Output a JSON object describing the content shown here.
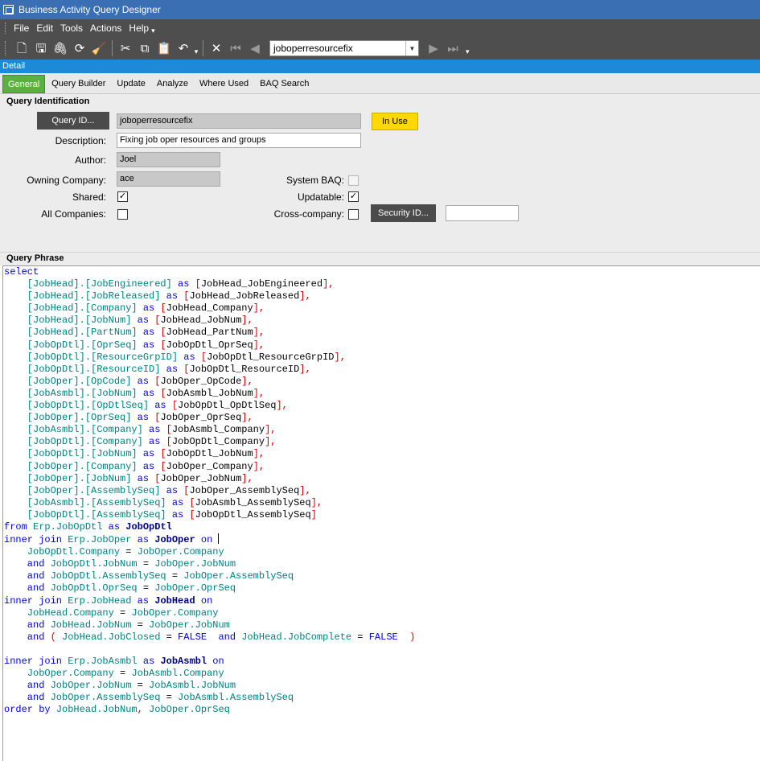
{
  "window": {
    "title": "Business Activity Query Designer"
  },
  "menu": [
    "File",
    "Edit",
    "Tools",
    "Actions",
    "Help"
  ],
  "toolbar": {
    "icons": [
      "new-icon",
      "save-icon",
      "attach-icon",
      "refresh-icon",
      "clear-icon",
      "cut-icon",
      "copy-icon",
      "paste-icon",
      "undo-icon",
      "delete-icon",
      "first-record-icon",
      "previous-record-icon",
      "next-record-icon",
      "last-record-icon"
    ],
    "record_combo_value": "joboperresourcefix"
  },
  "detail_bar": "Detail",
  "tabs": [
    "General",
    "Query Builder",
    "Update",
    "Analyze",
    "Where Used",
    "BAQ Search"
  ],
  "query_identification": {
    "section_title": "Query Identification",
    "query_id_button": "Query ID...",
    "query_id_value": "joboperresourcefix",
    "in_use_label": "In Use",
    "description_label": "Description:",
    "description_value": "Fixing job oper resources and groups",
    "author_label": "Author:",
    "author_value": "Joel",
    "owning_company_label": "Owning Company:",
    "owning_company_value": "ace",
    "system_baq_label": "System BAQ:",
    "system_baq_checked": false,
    "shared_label": "Shared:",
    "shared_checked": true,
    "updatable_label": "Updatable:",
    "updatable_checked": true,
    "all_companies_label": "All Companies:",
    "all_companies_checked": false,
    "cross_company_label": "Cross-company:",
    "cross_company_checked": false,
    "security_id_button": "Security ID...",
    "security_id_value": ""
  },
  "query_phrase": {
    "section_title": "Query Phrase",
    "lines": [
      [
        [
          "kw",
          "select"
        ]
      ],
      [
        [
          "id",
          "    [JobHead].[JobEngineered]"
        ],
        [
          "kw",
          " as "
        ],
        [
          "sym",
          "["
        ],
        [
          "alias",
          "JobHead_JobEngineered"
        ],
        [
          "sym",
          "],"
        ]
      ],
      [
        [
          "id",
          "    [JobHead].[JobReleased]"
        ],
        [
          "kw",
          " as "
        ],
        [
          "sym",
          "["
        ],
        [
          "alias",
          "JobHead_JobReleased"
        ],
        [
          "sym",
          "],"
        ]
      ],
      [
        [
          "id",
          "    [JobHead].[Company]"
        ],
        [
          "kw",
          " as "
        ],
        [
          "sym",
          "["
        ],
        [
          "alias",
          "JobHead_Company"
        ],
        [
          "sym",
          "],"
        ]
      ],
      [
        [
          "id",
          "    [JobHead].[JobNum]"
        ],
        [
          "kw",
          " as "
        ],
        [
          "sym",
          "["
        ],
        [
          "alias",
          "JobHead_JobNum"
        ],
        [
          "sym",
          "],"
        ]
      ],
      [
        [
          "id",
          "    [JobHead].[PartNum]"
        ],
        [
          "kw",
          " as "
        ],
        [
          "sym",
          "["
        ],
        [
          "alias",
          "JobHead_PartNum"
        ],
        [
          "sym",
          "],"
        ]
      ],
      [
        [
          "id",
          "    [JobOpDtl].[OprSeq]"
        ],
        [
          "kw",
          " as "
        ],
        [
          "sym",
          "["
        ],
        [
          "alias",
          "JobOpDtl_OprSeq"
        ],
        [
          "sym",
          "],"
        ]
      ],
      [
        [
          "id",
          "    [JobOpDtl].[ResourceGrpID]"
        ],
        [
          "kw",
          " as "
        ],
        [
          "sym",
          "["
        ],
        [
          "alias",
          "JobOpDtl_ResourceGrpID"
        ],
        [
          "sym",
          "],"
        ]
      ],
      [
        [
          "id",
          "    [JobOpDtl].[ResourceID]"
        ],
        [
          "kw",
          " as "
        ],
        [
          "sym",
          "["
        ],
        [
          "alias",
          "JobOpDtl_ResourceID"
        ],
        [
          "sym",
          "],"
        ]
      ],
      [
        [
          "id",
          "    [JobOper].[OpCode]"
        ],
        [
          "kw",
          " as "
        ],
        [
          "sym",
          "["
        ],
        [
          "alias",
          "JobOper_OpCode"
        ],
        [
          "sym",
          "],"
        ]
      ],
      [
        [
          "id",
          "    [JobAsmbl].[JobNum]"
        ],
        [
          "kw",
          " as "
        ],
        [
          "sym",
          "["
        ],
        [
          "alias",
          "JobAsmbl_JobNum"
        ],
        [
          "sym",
          "],"
        ]
      ],
      [
        [
          "id",
          "    [JobOpDtl].[OpDtlSeq]"
        ],
        [
          "kw",
          " as "
        ],
        [
          "sym",
          "["
        ],
        [
          "alias",
          "JobOpDtl_OpDtlSeq"
        ],
        [
          "sym",
          "],"
        ]
      ],
      [
        [
          "id",
          "    [JobOper].[OprSeq]"
        ],
        [
          "kw",
          " as "
        ],
        [
          "sym",
          "["
        ],
        [
          "alias",
          "JobOper_OprSeq"
        ],
        [
          "sym",
          "],"
        ]
      ],
      [
        [
          "id",
          "    [JobAsmbl].[Company]"
        ],
        [
          "kw",
          " as "
        ],
        [
          "sym",
          "["
        ],
        [
          "alias",
          "JobAsmbl_Company"
        ],
        [
          "sym",
          "],"
        ]
      ],
      [
        [
          "id",
          "    [JobOpDtl].[Company]"
        ],
        [
          "kw",
          " as "
        ],
        [
          "sym",
          "["
        ],
        [
          "alias",
          "JobOpDtl_Company"
        ],
        [
          "sym",
          "],"
        ]
      ],
      [
        [
          "id",
          "    [JobOpDtl].[JobNum]"
        ],
        [
          "kw",
          " as "
        ],
        [
          "sym",
          "["
        ],
        [
          "alias",
          "JobOpDtl_JobNum"
        ],
        [
          "sym",
          "],"
        ]
      ],
      [
        [
          "id",
          "    [JobOper].[Company]"
        ],
        [
          "kw",
          " as "
        ],
        [
          "sym",
          "["
        ],
        [
          "alias",
          "JobOper_Company"
        ],
        [
          "sym",
          "],"
        ]
      ],
      [
        [
          "id",
          "    [JobOper].[JobNum]"
        ],
        [
          "kw",
          " as "
        ],
        [
          "sym",
          "["
        ],
        [
          "alias",
          "JobOper_JobNum"
        ],
        [
          "sym",
          "],"
        ]
      ],
      [
        [
          "id",
          "    [JobOper].[AssemblySeq]"
        ],
        [
          "kw",
          " as "
        ],
        [
          "sym",
          "["
        ],
        [
          "alias",
          "JobOper_AssemblySeq"
        ],
        [
          "sym",
          "],"
        ]
      ],
      [
        [
          "id",
          "    [JobAsmbl].[AssemblySeq]"
        ],
        [
          "kw",
          " as "
        ],
        [
          "sym",
          "["
        ],
        [
          "alias",
          "JobAsmbl_AssemblySeq"
        ],
        [
          "sym",
          "],"
        ]
      ],
      [
        [
          "id",
          "    [JobOpDtl].[AssemblySeq]"
        ],
        [
          "kw",
          " as "
        ],
        [
          "sym",
          "["
        ],
        [
          "alias",
          "JobOpDtl_AssemblySeq"
        ],
        [
          "sym",
          "]"
        ]
      ],
      [
        [
          "kw",
          "from "
        ],
        [
          "id",
          "Erp.JobOpDtl"
        ],
        [
          "kw",
          " as "
        ],
        [
          "bold",
          "JobOpDtl"
        ]
      ],
      [
        [
          "kw",
          "inner join "
        ],
        [
          "id",
          "Erp.JobOper"
        ],
        [
          "kw",
          " as "
        ],
        [
          "bold",
          "JobOper"
        ],
        [
          "kw",
          " on "
        ],
        [
          "caret",
          ""
        ]
      ],
      [
        [
          "id",
          "    JobOpDtl.Company"
        ],
        [
          "alias",
          " = "
        ],
        [
          "id",
          "JobOper.Company"
        ]
      ],
      [
        [
          "kw",
          "    and "
        ],
        [
          "id",
          "JobOpDtl.JobNum"
        ],
        [
          "alias",
          " = "
        ],
        [
          "id",
          "JobOper.JobNum"
        ]
      ],
      [
        [
          "kw",
          "    and "
        ],
        [
          "id",
          "JobOpDtl.AssemblySeq"
        ],
        [
          "alias",
          " = "
        ],
        [
          "id",
          "JobOper.AssemblySeq"
        ]
      ],
      [
        [
          "kw",
          "    and "
        ],
        [
          "id",
          "JobOpDtl.OprSeq"
        ],
        [
          "alias",
          " = "
        ],
        [
          "id",
          "JobOper.OprSeq"
        ]
      ],
      [
        [
          "kw",
          "inner join "
        ],
        [
          "id",
          "Erp.JobHead"
        ],
        [
          "kw",
          " as "
        ],
        [
          "bold",
          "JobHead"
        ],
        [
          "kw",
          " on"
        ]
      ],
      [
        [
          "id",
          "    JobHead.Company"
        ],
        [
          "alias",
          " = "
        ],
        [
          "id",
          "JobOper.Company"
        ]
      ],
      [
        [
          "kw",
          "    and "
        ],
        [
          "id",
          "JobHead.JobNum"
        ],
        [
          "alias",
          " = "
        ],
        [
          "id",
          "JobOper.JobNum"
        ]
      ],
      [
        [
          "kw",
          "    and "
        ],
        [
          "sym",
          "( "
        ],
        [
          "id",
          "JobHead.JobClosed"
        ],
        [
          "alias",
          " = "
        ],
        [
          "kw",
          "FALSE"
        ],
        [
          "kw",
          "  and "
        ],
        [
          "id",
          "JobHead.JobComplete"
        ],
        [
          "alias",
          " = "
        ],
        [
          "kw",
          "FALSE"
        ],
        [
          "sym",
          "  )"
        ]
      ],
      [
        [
          "alias",
          " "
        ]
      ],
      [
        [
          "kw",
          "inner join "
        ],
        [
          "id",
          "Erp.JobAsmbl"
        ],
        [
          "kw",
          " as "
        ],
        [
          "bold",
          "JobAsmbl"
        ],
        [
          "kw",
          " on"
        ]
      ],
      [
        [
          "id",
          "    JobOper.Company"
        ],
        [
          "alias",
          " = "
        ],
        [
          "id",
          "JobAsmbl.Company"
        ]
      ],
      [
        [
          "kw",
          "    and "
        ],
        [
          "id",
          "JobOper.JobNum"
        ],
        [
          "alias",
          " = "
        ],
        [
          "id",
          "JobAsmbl.JobNum"
        ]
      ],
      [
        [
          "kw",
          "    and "
        ],
        [
          "id",
          "JobOper.AssemblySeq"
        ],
        [
          "alias",
          " = "
        ],
        [
          "id",
          "JobAsmbl.AssemblySeq"
        ]
      ],
      [
        [
          "kw",
          "order by "
        ],
        [
          "id",
          "JobHead.JobNum"
        ],
        [
          "sym",
          ", "
        ],
        [
          "id",
          "JobOper.OprSeq"
        ]
      ]
    ]
  }
}
